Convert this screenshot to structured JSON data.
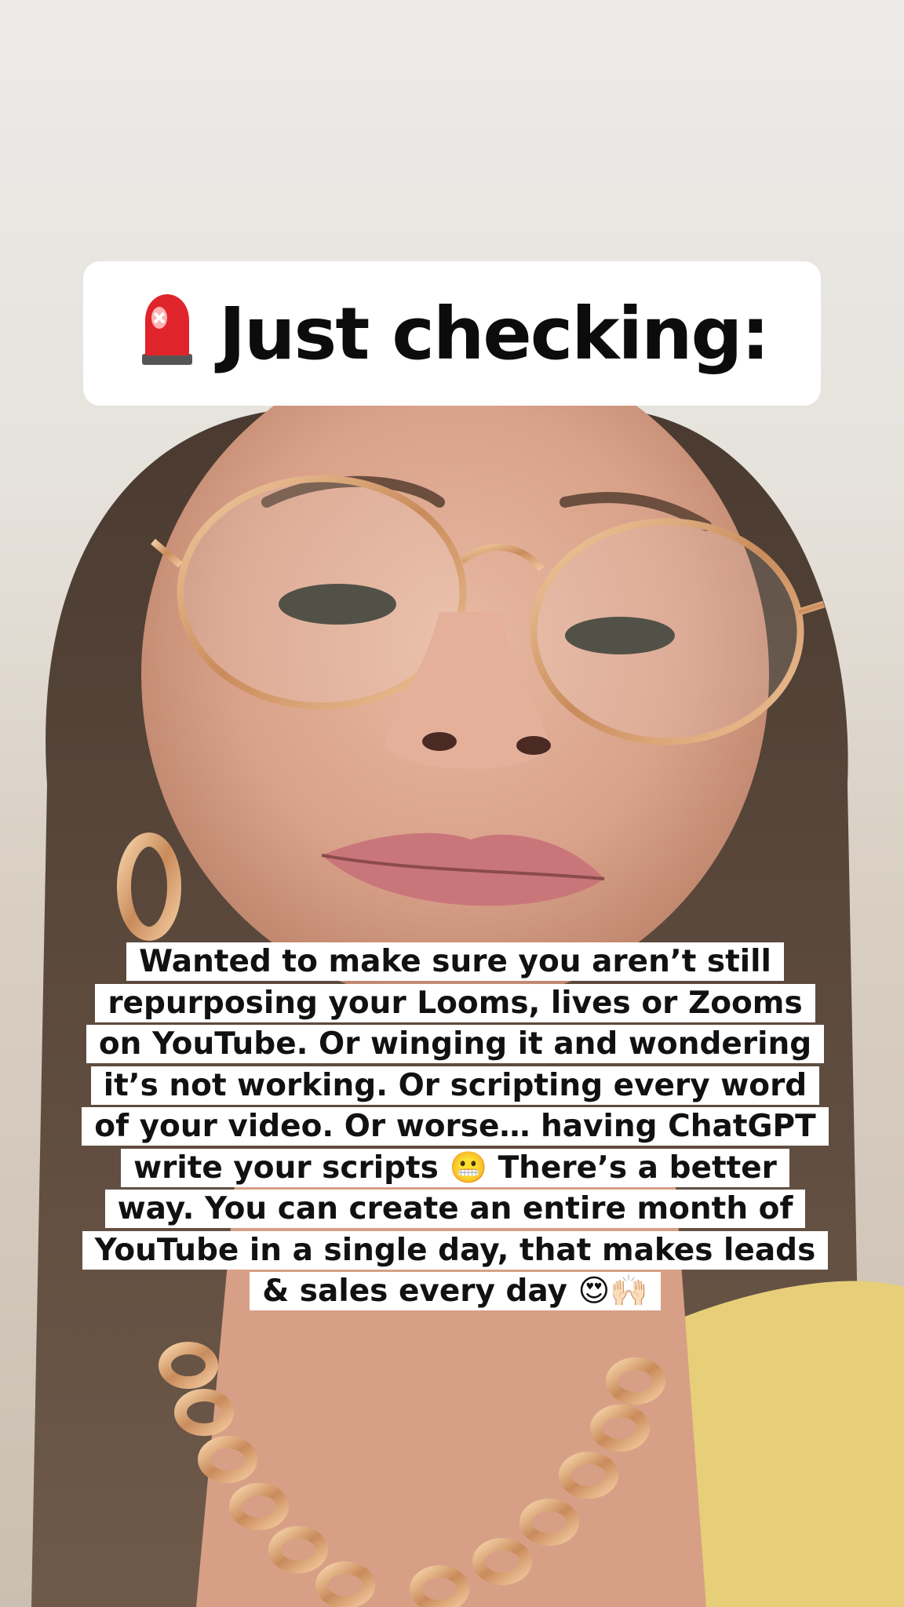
{
  "title": {
    "icon": "police-siren-icon",
    "text": "Just checking:"
  },
  "caption": {
    "lines": [
      "Wanted to make sure you aren’t still",
      "repurposing your Looms, lives or Zooms",
      "on YouTube. Or winging it and wondering",
      "it’s not working. Or scripting every word",
      "of your video. Or worse… having ChatGPT",
      "write your scripts 😬 There’s a better",
      "way. You can create an entire month of",
      "YouTube in a single day, that makes leads",
      "& sales every day 😍🙌🏻"
    ]
  },
  "colors": {
    "caption_background": "#ffffff",
    "text": "#111111",
    "siren_red": "#e0242b",
    "shirt_yellow": "#e6cf78"
  }
}
